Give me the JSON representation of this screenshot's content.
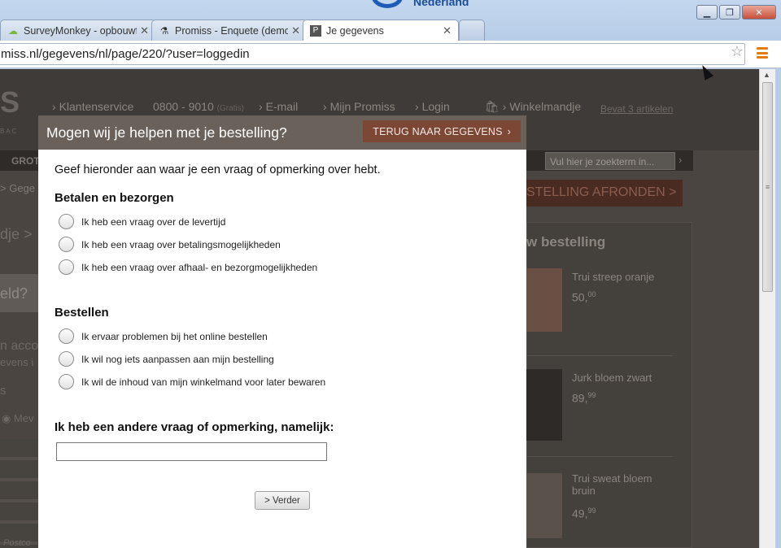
{
  "browser": {
    "tabs": [
      {
        "label": "SurveyMonkey - opbouwf",
        "icon": "surveymonkey-icon"
      },
      {
        "label": "Promiss - Enquete (demo)",
        "icon": "flask-icon"
      },
      {
        "label": "Je gegevens",
        "icon": "promiss-icon",
        "active": true
      }
    ],
    "address": "miss.nl/gegevens/nl/page/220/?user=loggedin",
    "top_banner": "Nederland"
  },
  "site": {
    "logo": "S",
    "logo_sub": "BAC",
    "topnav": {
      "klantenservice": "Klantenservice",
      "phone": "0800 - 9010",
      "phone_note": "(Gratis)",
      "email": "E-mail",
      "mijn": "Mijn Promiss",
      "login": "Login",
      "winkelmandje": "Winkelmandje",
      "bevat": "Bevat 3 artikelen"
    },
    "navbar_text": "GROT",
    "search_placeholder": "Vul hier je zoekterm in...",
    "left": {
      "crumb": "> Gege",
      "text1": "dje  >",
      "text2": "eld?",
      "text3": "n acco",
      "text4": "evens i",
      "text5": "s",
      "radio": "Mev",
      "postcode": "Postco"
    },
    "afronden": "STELLING AFRONDEN  >",
    "side_title": "w bestelling",
    "products": [
      {
        "name": "Trui streep oranje",
        "price_int": "50,",
        "price_dec": "00"
      },
      {
        "name": "Jurk bloem zwart",
        "price_int": "89,",
        "price_dec": "99"
      },
      {
        "name": "Trui sweat bloem bruin",
        "price_int": "49,",
        "price_dec": "99"
      }
    ]
  },
  "modal": {
    "title": "Mogen wij je helpen met je bestelling?",
    "back_button": "TERUG NAAR GEGEVENS",
    "intro": "Geef hieronder aan waar je een vraag of opmerking over hebt.",
    "section1": {
      "title": "Betalen en bezorgen",
      "options": [
        "Ik heb een vraag over de levertijd",
        "Ik heb een vraag over betalingsmogelijkheden",
        "Ik heb een vraag over afhaal- en bezorgmogelijkheden"
      ]
    },
    "section2": {
      "title": "Bestellen",
      "options": [
        "Ik ervaar problemen bij het online bestellen",
        "Ik wil nog iets aanpassen aan mijn bestelling",
        "Ik wil de inhoud van mijn winkelmand voor later bewaren"
      ]
    },
    "other_label": "Ik heb een andere vraag of opmerking, namelijk:",
    "other_value": "",
    "submit": "> Verder"
  },
  "colors": {
    "modal_header": "#6b615b",
    "back_button": "#7d4736",
    "overlay": "#4a4541",
    "menu_accent": "#e07b0c"
  }
}
